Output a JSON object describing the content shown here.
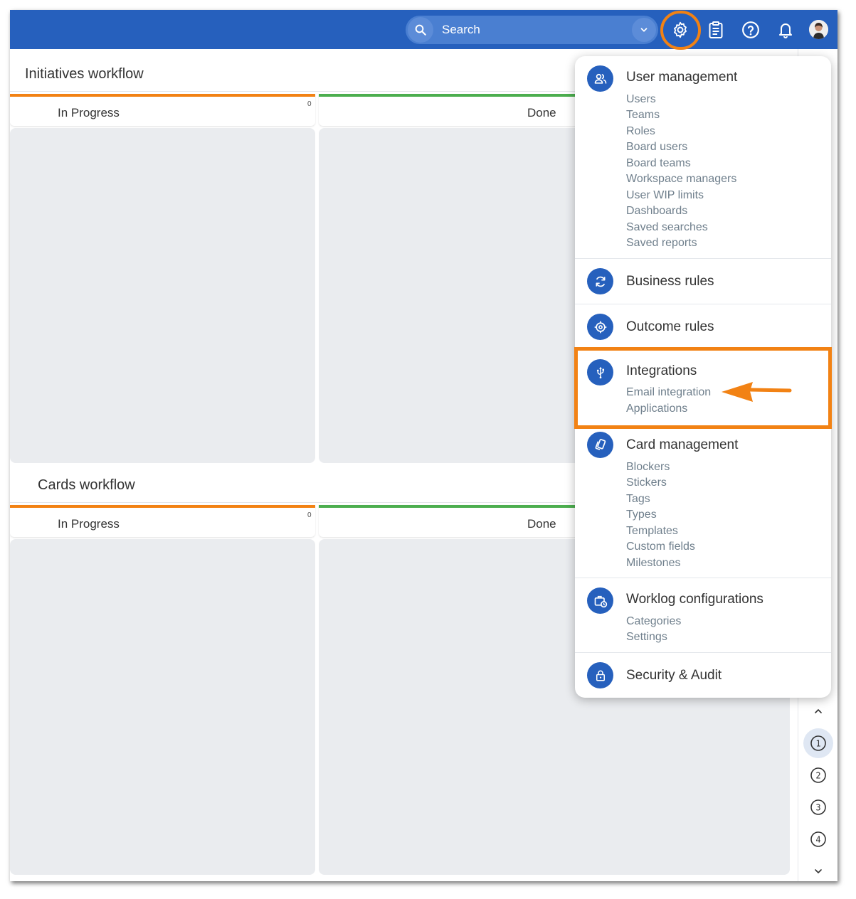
{
  "topbar": {
    "search_placeholder": "Search",
    "icons": [
      "search-icon",
      "chevron-down-icon",
      "gear-icon",
      "clipboard-icon",
      "help-icon",
      "bell-icon",
      "avatar"
    ],
    "brand_color": "#2660bd",
    "highlight_color": "#f28214"
  },
  "boards": [
    {
      "title": "Initiatives workflow",
      "columns": [
        {
          "label": "In Progress",
          "count": "0",
          "color": "#f28214"
        },
        {
          "label": "Done",
          "color": "#4cae4f"
        }
      ]
    },
    {
      "title": "Cards workflow",
      "columns": [
        {
          "label": "In Progress",
          "count": "0",
          "color": "#f28214"
        },
        {
          "label": "Done",
          "color": "#4cae4f"
        }
      ]
    }
  ],
  "menu": {
    "sections": [
      {
        "title": "User management",
        "icon": "users-icon",
        "items": [
          "Users",
          "Teams",
          "Roles",
          "Board users",
          "Board teams",
          "Workspace managers",
          "User WIP limits",
          "Dashboards",
          "Saved searches",
          "Saved reports"
        ]
      },
      {
        "title": "Business rules",
        "icon": "sync-icon",
        "items": []
      },
      {
        "title": "Outcome rules",
        "icon": "target-icon",
        "items": []
      },
      {
        "title": "Integrations",
        "icon": "usb-icon",
        "items": [
          "Email integration",
          "Applications"
        ]
      },
      {
        "title": "Card management",
        "icon": "cards-icon",
        "items": [
          "Blockers",
          "Stickers",
          "Tags",
          "Types",
          "Templates",
          "Custom fields",
          "Milestones"
        ]
      },
      {
        "title": "Worklog configurations",
        "icon": "briefcase-clock-icon",
        "items": [
          "Categories",
          "Settings"
        ]
      },
      {
        "title": "Security & Audit",
        "icon": "lock-icon",
        "items": []
      }
    ]
  },
  "rail": {
    "buttons": [
      "1",
      "2",
      "3",
      "4"
    ],
    "active": "1",
    "icons": [
      "chevron-up-icon",
      "chevron-down-icon"
    ]
  }
}
